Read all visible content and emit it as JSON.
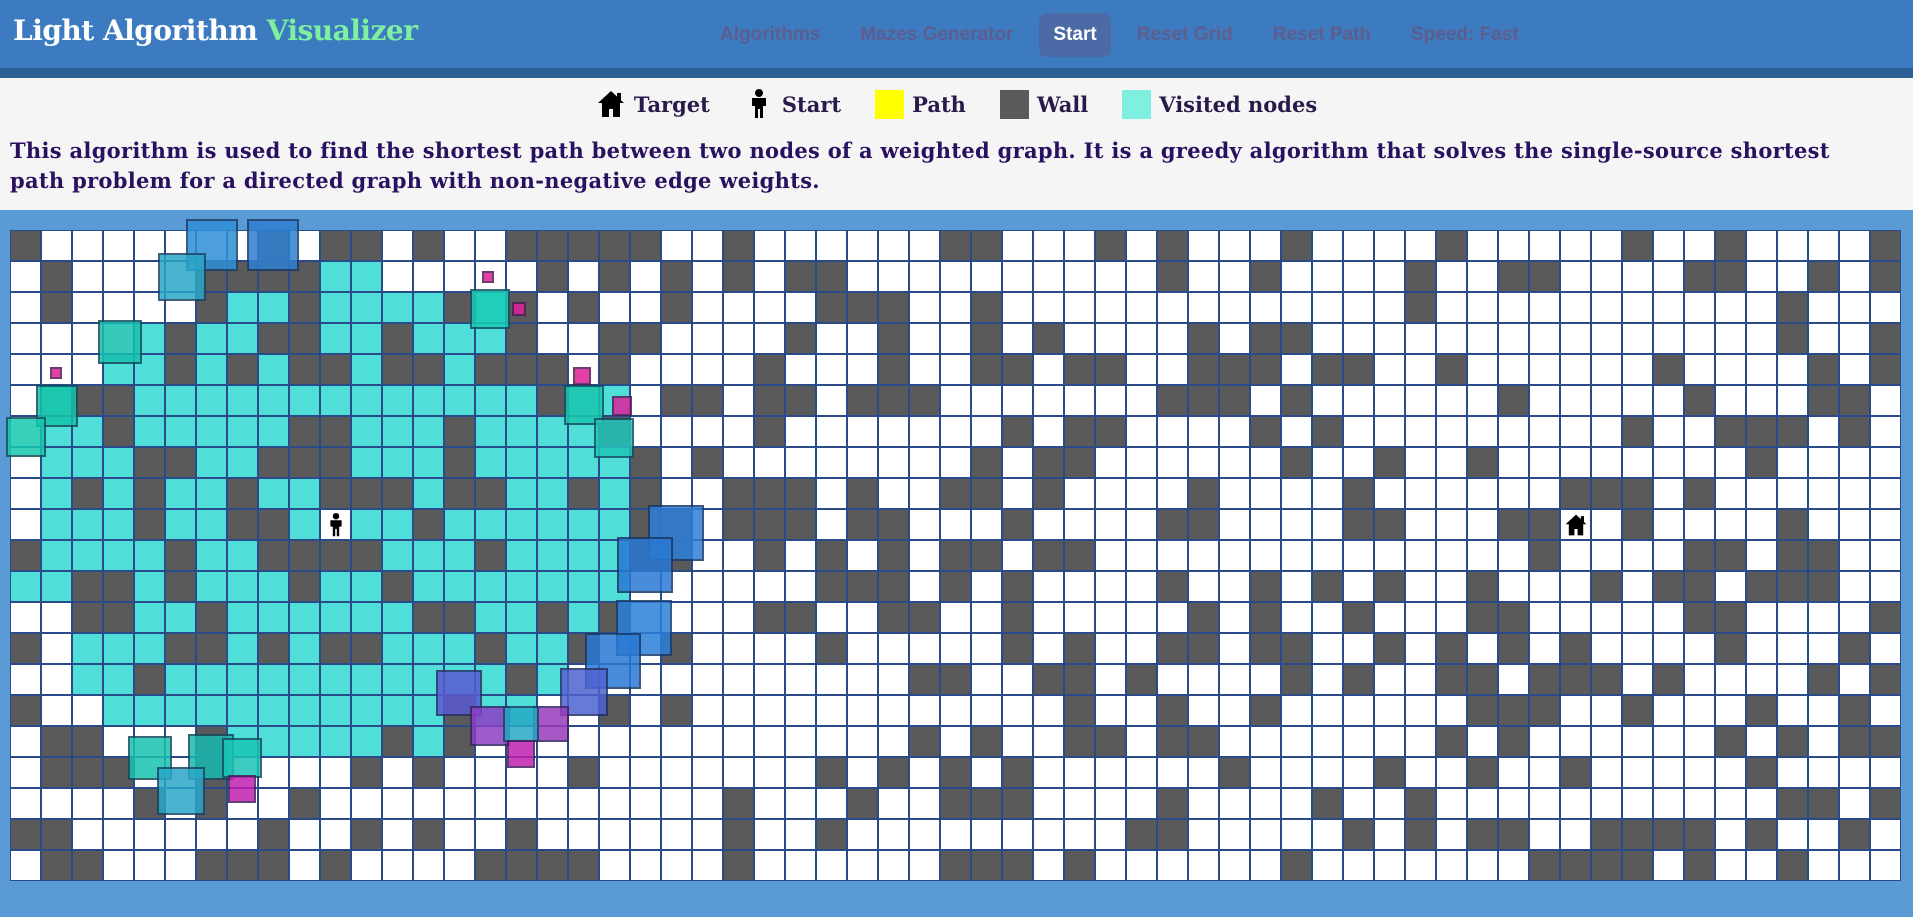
{
  "brand": {
    "title": "Light Algorithm",
    "accent": "Visualizer"
  },
  "nav": {
    "algorithms": "Algorithms",
    "mazes": "Mazes Generator",
    "start": "Start",
    "reset_grid": "Reset Grid",
    "reset_path": "Reset Path",
    "speed": "Speed: Fast"
  },
  "legend": {
    "target": "Target",
    "start": "Start",
    "path": "Path",
    "wall": "Wall",
    "visited": "Visited nodes"
  },
  "description": "This algorithm is used to find the shortest path between two nodes of a weighted graph. It is a greedy algorithm that solves the single-source shortest path problem for a directed graph with non-negative edge weights.",
  "grid": {
    "rows": 21,
    "cols": 61,
    "start": [
      9,
      10
    ],
    "target": [
      9,
      50
    ]
  },
  "colors": {
    "navbar": "#3c7bbf",
    "brand_accent": "#7ff0a0",
    "path": "#ffff00",
    "wall": "#5a5a5a",
    "visited": "#4fdfd8",
    "background": "#5b9bd5"
  }
}
